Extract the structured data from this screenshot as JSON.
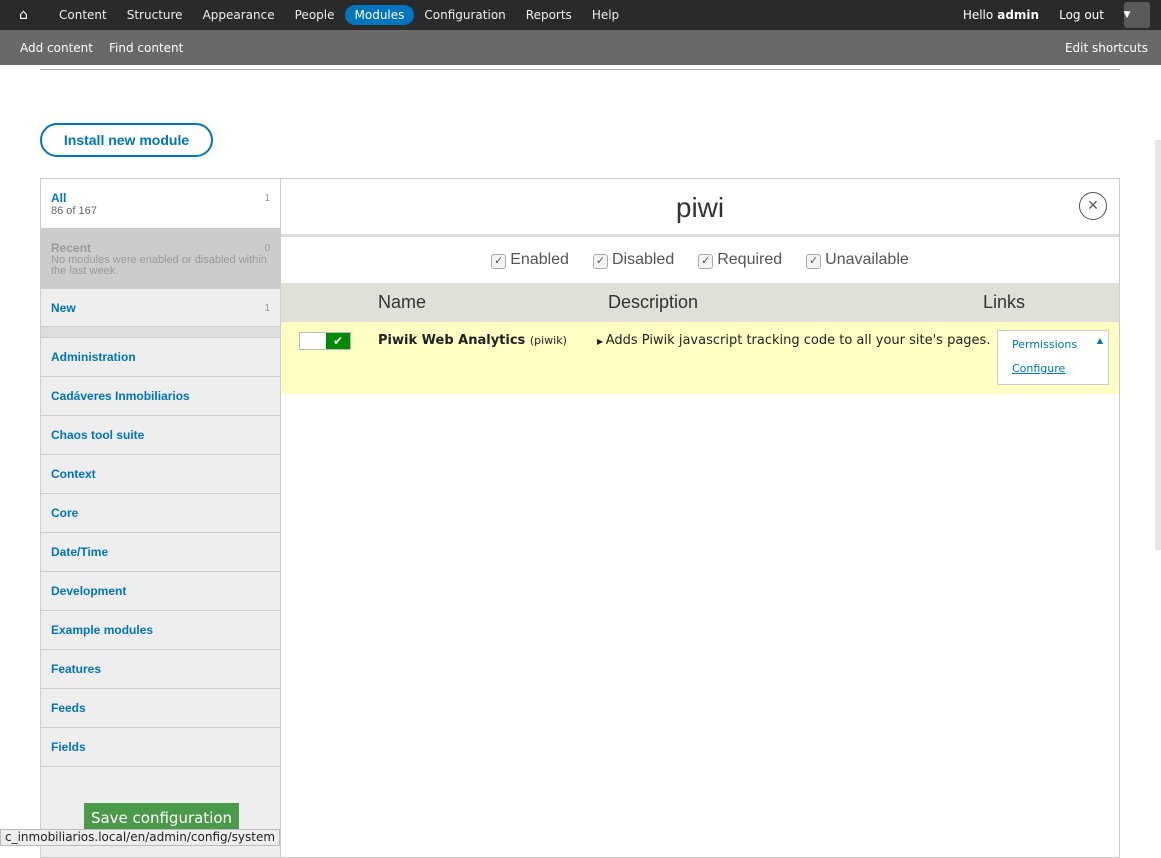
{
  "toolbar": {
    "nav": [
      "Content",
      "Structure",
      "Appearance",
      "People",
      "Modules",
      "Configuration",
      "Reports",
      "Help"
    ],
    "active": "Modules",
    "hello": "Hello",
    "user": "admin",
    "logout": "Log out"
  },
  "shortcuts": {
    "items": [
      "Add content",
      "Find content"
    ],
    "edit": "Edit shortcuts"
  },
  "install_button": "Install new module",
  "sidebar": {
    "all": {
      "label": "All",
      "count": "1",
      "sub": "86 of 167"
    },
    "recent": {
      "label": "Recent",
      "count": "0",
      "sub": "No modules were enabled or disabled within the last week."
    },
    "new": {
      "label": "New",
      "count": "1"
    },
    "categories": [
      "Administration",
      "Cadáveres Inmobiliarios",
      "Chaos tool suite",
      "Context",
      "Core",
      "Date/Time",
      "Development",
      "Example modules",
      "Features",
      "Feeds",
      "Fields"
    ],
    "save": "Save configuration"
  },
  "search": {
    "value": "piwi"
  },
  "filters": [
    "Enabled",
    "Disabled",
    "Required",
    "Unavailable"
  ],
  "table": {
    "headers": [
      "Name",
      "Description",
      "Links"
    ],
    "rows": [
      {
        "name": "Piwik Web Analytics",
        "machine": "(piwik)",
        "description": "Adds Piwik javascript tracking code to all your site's pages.",
        "enabled": true,
        "links": [
          "Permissions",
          "Configure"
        ]
      }
    ]
  },
  "status_url": "c_inmobiliarios.local/en/admin/config/system",
  "colors": {
    "accent": "#0074bd",
    "toolbar": "#2a2a2a",
    "enabled": "#008a00",
    "row_highlight": "#ffffc4"
  }
}
